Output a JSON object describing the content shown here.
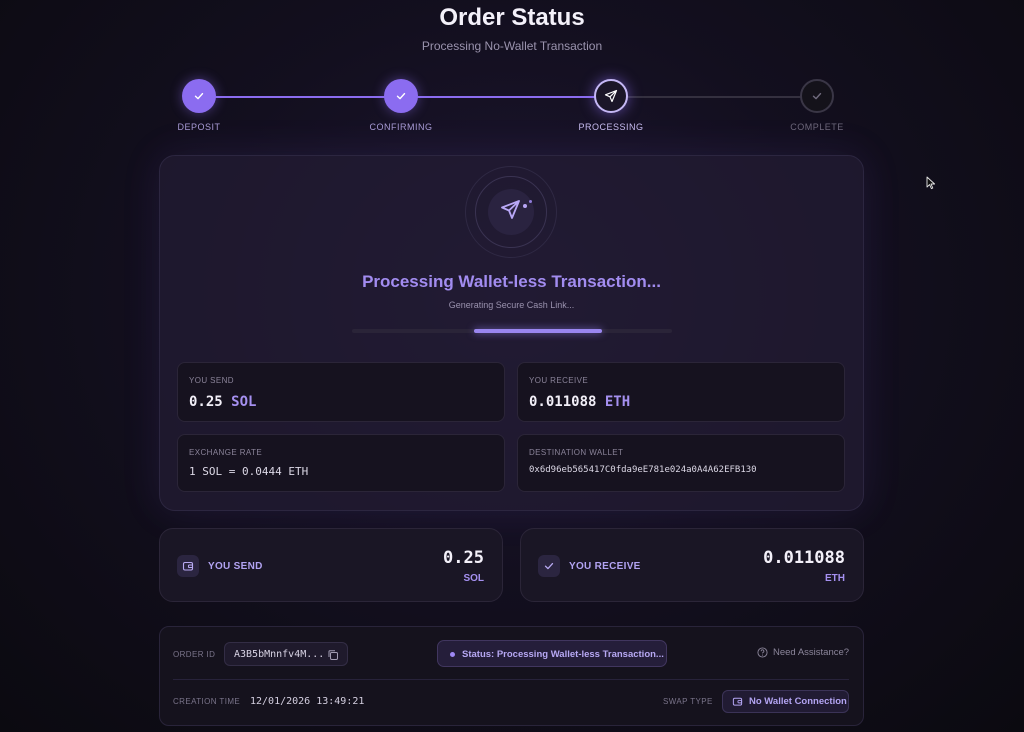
{
  "header": {
    "title": "Order Status",
    "subtitle": "Processing No-Wallet Transaction"
  },
  "stepper": {
    "steps": [
      {
        "label": "DEPOSIT",
        "state": "complete"
      },
      {
        "label": "CONFIRMING",
        "state": "complete"
      },
      {
        "label": "PROCESSING",
        "state": "active"
      },
      {
        "label": "COMPLETE",
        "state": "pending"
      }
    ]
  },
  "processing": {
    "title": "Processing Wallet-less Transaction...",
    "subtitle": "Generating Secure Cash Link...",
    "icon": "send-icon"
  },
  "details": {
    "you_send": {
      "label": "YOU SEND",
      "amount": "0.25",
      "unit": "SOL"
    },
    "you_receive": {
      "label": "YOU RECEIVE",
      "amount": "0.011088",
      "unit": "ETH"
    },
    "exchange_rate": {
      "label": "EXCHANGE RATE",
      "value": "1 SOL = 0.0444 ETH"
    },
    "destination_wallet": {
      "label": "DESTINATION WALLET",
      "value": "0x6d96eb565417C0fda9eE781e024a0A4A62EFB130"
    }
  },
  "summary": {
    "send": {
      "label": "YOU SEND",
      "amount": "0.25",
      "unit": "SOL",
      "icon": "wallet-icon"
    },
    "receive": {
      "label": "YOU RECEIVE",
      "amount": "0.011088",
      "unit": "ETH",
      "icon": "check-icon"
    }
  },
  "order": {
    "id_label": "ORDER ID",
    "id_value": "A3B5bMnnfv4M...",
    "status": "Status: Processing Wallet-less Transaction...",
    "help": "Need Assistance?",
    "creation_label": "CREATION TIME",
    "creation_value": "12/01/2026 13:49:21",
    "swap_type_label": "SWAP TYPE",
    "swap_type_value": "No Wallet Connection"
  },
  "colors": {
    "accent": "#8b6cf0",
    "background": "#130f1f",
    "card": "#1a1625"
  }
}
